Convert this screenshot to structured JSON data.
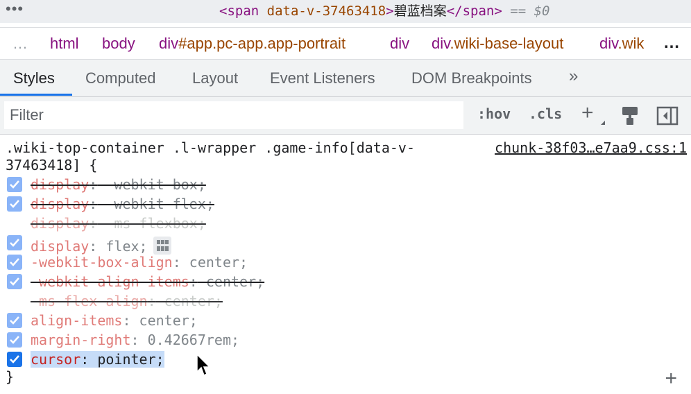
{
  "element": {
    "tag_open": "<span",
    "attr": "data-v-37463418",
    "text": "碧蓝档案",
    "tag_close": "</span>",
    "eq": "==",
    "ref": "$0"
  },
  "breadcrumbs": [
    {
      "tag": "html",
      "rest": ""
    },
    {
      "tag": "body",
      "rest": ""
    },
    {
      "tag": "div",
      "rest": "#app.pc-app.app-portrait"
    },
    {
      "tag": "div",
      "rest": ""
    },
    {
      "tag": "div",
      "rest": ".wiki-base-layout"
    },
    {
      "tag": "div",
      "rest": ".wik"
    }
  ],
  "tabs": [
    "Styles",
    "Computed",
    "Layout",
    "Event Listeners",
    "DOM Breakpoints"
  ],
  "tabs_overflow": "»",
  "filter": {
    "placeholder": "Filter",
    "hov": ":hov",
    "cls": ".cls",
    "add": "+"
  },
  "rule": {
    "selector": ".wiki-top-container .l-wrapper .game-info[data-v-\n37463418] {",
    "source": "chunk-38f03…e7aa9.css:1",
    "closing": "}",
    "add": "+",
    "declarations": [
      {
        "prop": "display",
        "value": " -webkit-box;",
        "checkbox": true,
        "state": "overridden"
      },
      {
        "prop": "display",
        "value": " -webkit-flex;",
        "checkbox": true,
        "state": "overridden"
      },
      {
        "prop": "display",
        "value": " -ms-flexbox;",
        "checkbox": false,
        "state": "invalid"
      },
      {
        "prop": "display",
        "value": " flex;",
        "checkbox": true,
        "state": "active",
        "flex_icon": true
      },
      {
        "prop": "-webkit-box-align",
        "value": " center;",
        "checkbox": true,
        "state": "active"
      },
      {
        "prop": "-webkit-align-items",
        "value": " center;",
        "checkbox": true,
        "state": "overridden"
      },
      {
        "prop": "-ms-flex-align",
        "value": " center;",
        "checkbox": false,
        "state": "invalid"
      },
      {
        "prop": "align-items",
        "value": " center;",
        "checkbox": true,
        "state": "active"
      },
      {
        "prop": "margin-right",
        "value": " 0.42667rem;",
        "checkbox": true,
        "state": "active"
      },
      {
        "prop": "cursor",
        "value": " pointer;",
        "checkbox": true,
        "state": "selected"
      }
    ]
  },
  "colors": {
    "accent": "#1a73e8",
    "tag": "#881280",
    "attr": "#994500",
    "property": "#c5221f",
    "selection": "#c6dcf8"
  }
}
